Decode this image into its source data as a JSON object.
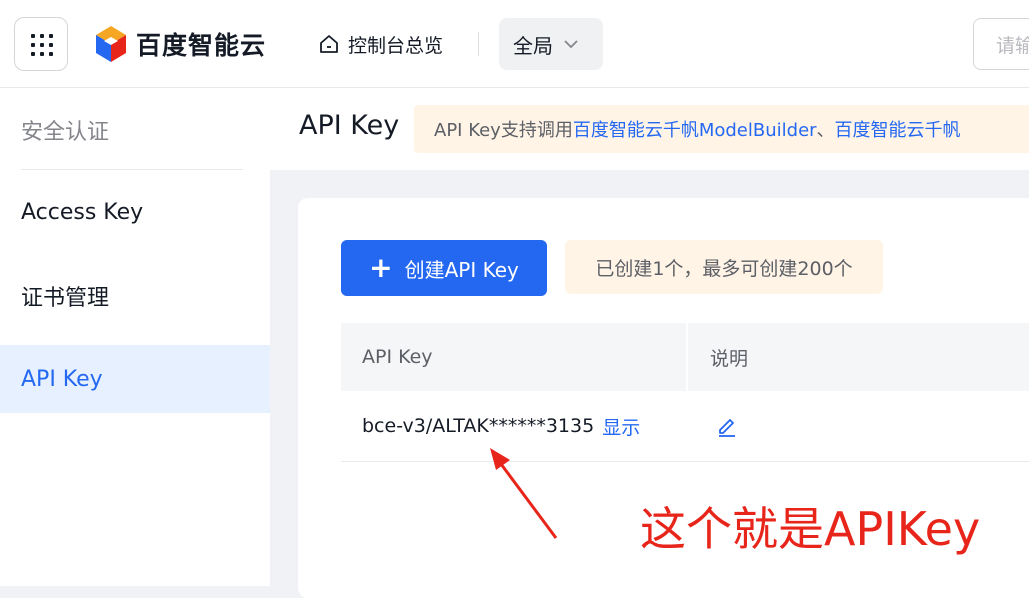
{
  "header": {
    "logo_text": "百度智能云",
    "console_label": "控制台总览",
    "region_label": "全局",
    "search_placeholder": "请输"
  },
  "sidebar": {
    "title": "安全认证",
    "items": [
      {
        "label": "Access Key",
        "active": false
      },
      {
        "label": "证书管理",
        "active": false
      },
      {
        "label": "API Key",
        "active": true
      }
    ]
  },
  "main": {
    "title": "API Key",
    "notice": {
      "prefix": "API Key支持调用",
      "link1": "百度智能云千帆ModelBuilder",
      "separator": "、",
      "link2": "百度智能云千帆"
    },
    "create_button": "创建API Key",
    "count_tip": "已创建1个，最多可创建200个",
    "table": {
      "headers": [
        "API Key",
        "说明"
      ],
      "rows": [
        {
          "api_key": "bce-v3/ALTAK******3135",
          "show_label": "显示"
        }
      ]
    }
  },
  "annotation": {
    "text": "这个就是APIKey",
    "color": "#e8251a"
  },
  "colors": {
    "accent": "#2468f2",
    "notice_bg": "#fff4e6",
    "active_bg": "#e6f0ff"
  }
}
